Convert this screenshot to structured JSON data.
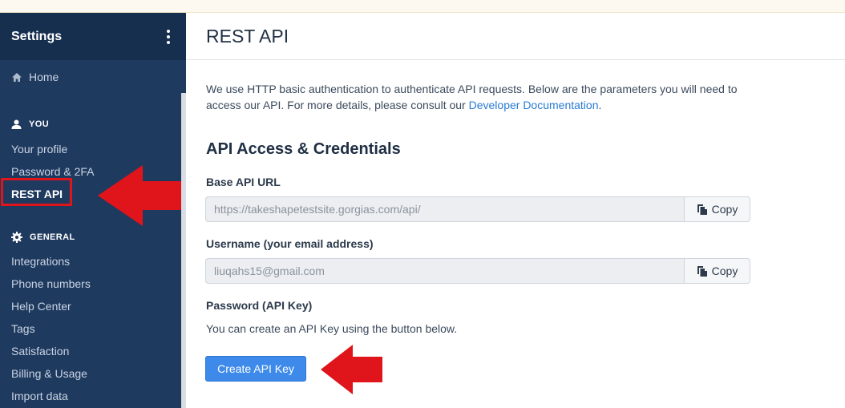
{
  "sidebar": {
    "title": "Settings",
    "home_label": "Home",
    "sections": [
      {
        "label": "YOU",
        "icon": "user-icon",
        "items": [
          {
            "label": "Your profile"
          },
          {
            "label": "Password & 2FA"
          },
          {
            "label": "REST API",
            "active": true
          }
        ]
      },
      {
        "label": "GENERAL",
        "icon": "gear-icon",
        "items": [
          {
            "label": "Integrations"
          },
          {
            "label": "Phone numbers"
          },
          {
            "label": "Help Center"
          },
          {
            "label": "Tags"
          },
          {
            "label": "Satisfaction"
          },
          {
            "label": "Billing & Usage"
          },
          {
            "label": "Import data"
          }
        ]
      }
    ]
  },
  "page": {
    "title": "REST API",
    "intro_text": "We use HTTP basic authentication to authenticate API requests. Below are the parameters you will need to access our API. For more details, please consult our ",
    "intro_link": "Developer Documentation",
    "intro_end": ".",
    "section_title": "API Access & Credentials",
    "base_url": {
      "label": "Base API URL",
      "value": "https://takeshapetestsite.gorgias.com/api/",
      "copy_label": "Copy"
    },
    "username": {
      "label": "Username (your email address)",
      "value": "liuqahs15@gmail.com",
      "copy_label": "Copy"
    },
    "password": {
      "label": "Password (API Key)",
      "helper": "You can create an API Key using the button below."
    },
    "create_button": "Create API Key"
  },
  "colors": {
    "sidebar_bg": "#1f3a5f",
    "sidebar_header_bg": "#172f4f",
    "primary_button": "#3d8aeb",
    "link": "#2a7bd3",
    "annotation_red": "#e0141b"
  }
}
